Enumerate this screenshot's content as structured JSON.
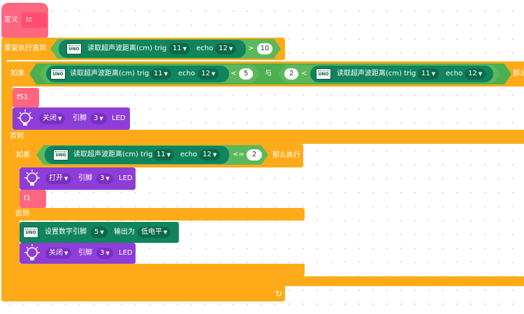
{
  "define_block": {
    "label": "定义",
    "name": "tc"
  },
  "repeat_until": {
    "label": "重复执行直到",
    "op": ">",
    "value": "10"
  },
  "sensor": {
    "label": "读取超声波距离(cm) trig",
    "trig": "11",
    "echo_label": "echo",
    "echo": "12"
  },
  "uno_icon_text": "UNO",
  "if1": {
    "label": "如果",
    "op1": "<",
    "value1": "5",
    "and_label": "与",
    "value2": "2",
    "op2": "<",
    "then_label": "那么"
  },
  "call_f51": "f51",
  "led1": {
    "state": "关闭",
    "pin_label": "引脚",
    "pin": "3",
    "suffix": "LED"
  },
  "else1": "否则",
  "if2": {
    "label": "如果",
    "op": "<=",
    "value": "2",
    "then_label": "那么执行"
  },
  "led2": {
    "state": "打开",
    "pin_label": "引脚",
    "pin": "3",
    "suffix": "LED"
  },
  "call_f1": "f1",
  "else2": "否则",
  "digital": {
    "label": "设置数字引脚",
    "pin": "5",
    "mid_label": "输出为",
    "level": "低电平"
  },
  "led3": {
    "state": "关闭",
    "pin_label": "引脚",
    "pin": "3",
    "suffix": "LED"
  },
  "loop_arrow": "↻",
  "colors": {
    "define": "#ff6680",
    "control": "#ffab19",
    "sensor": "#10845c",
    "operator": "#5cb85c",
    "light": "#8e3dd8"
  }
}
